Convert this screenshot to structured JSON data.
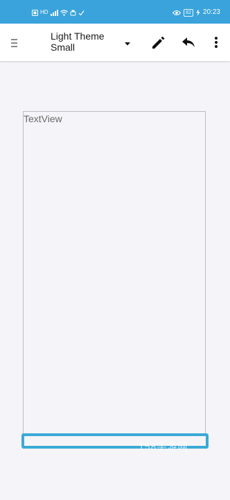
{
  "status_bar": {
    "left_icons": [
      "sim-icon",
      "network-icon",
      "signal-icon",
      "wifi-icon",
      "usb-icon",
      "check-icon"
    ],
    "network_label": "HD",
    "eye_icon": "eye-icon",
    "battery_level": "82",
    "time": "20:23"
  },
  "toolbar": {
    "menu_icon": "hamburger-icon",
    "title_line1": "Light Theme",
    "title_line2": "Small",
    "dropdown_icon": "dropdown-arrow-icon",
    "edit_icon": "pencil-icon",
    "undo_icon": "undo-icon",
    "more_icon": "more-vert-icon"
  },
  "canvas": {
    "textview_label": "TextView",
    "watermark": "158手游网"
  },
  "colors": {
    "status_bar": "#3aa3db",
    "toolbar": "#ffffff",
    "canvas_bg": "#f5f4f8",
    "selection_accent": "#3aaad6",
    "frame_border": "#bdbdbd"
  }
}
